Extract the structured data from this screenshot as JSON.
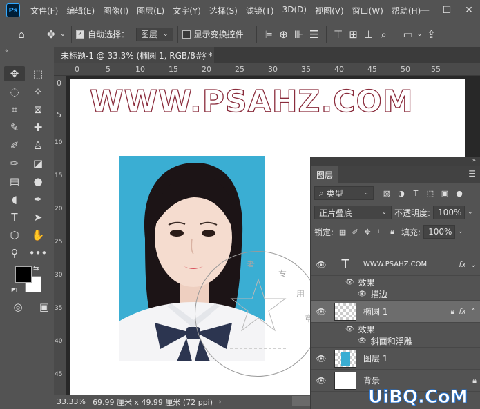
{
  "app": {
    "logo_text": "Ps",
    "menu": [
      "文件(F)",
      "编辑(E)",
      "图像(I)",
      "图层(L)",
      "文字(Y)",
      "选择(S)",
      "滤镜(T)",
      "3D(D)",
      "视图(V)",
      "窗口(W)",
      "帮助(H)"
    ],
    "window_controls": [
      "—",
      "☐",
      "✕"
    ]
  },
  "options_bar": {
    "auto_select_label": "自动选择：",
    "auto_select_checked": true,
    "auto_select_value": "图层",
    "show_transform_label": "显示变换控件",
    "show_transform_checked": false
  },
  "document": {
    "tab_title": "未标题-1 @ 33.3% (椭圆 1, RGB/8#) *",
    "close_glyph": "✕",
    "ruler_ticks": [
      "0",
      "5",
      "10",
      "15",
      "20",
      "25",
      "30",
      "35",
      "40",
      "45",
      "50",
      "55"
    ],
    "canvas_text": "WWW.PSAHZ.COM",
    "seal_text": [
      "者",
      "专",
      "用",
      "章"
    ]
  },
  "status_bar": {
    "zoom": "33.33%",
    "doc_info": "69.99 厘米 x 49.99 厘米 (72 ppi)",
    "arrow": "›"
  },
  "layers_panel": {
    "tab_label": "图层",
    "filter_kind": "类型",
    "blend_mode": "正片叠底",
    "opacity_label": "不透明度:",
    "opacity_value": "100%",
    "lock_label": "锁定:",
    "fill_label": "填充:",
    "fill_value": "100%",
    "layers": [
      {
        "name": "WWW.PSAHZ.COM",
        "thumb": "text",
        "selected": false,
        "fx": "fx",
        "effects_label": "效果",
        "effects": [
          "描边"
        ]
      },
      {
        "name": "椭圆 1",
        "thumb": "checker",
        "selected": true,
        "fx": "fx",
        "effects_label": "效果",
        "effects": [
          "斜面和浮雕"
        ]
      },
      {
        "name": "图层 1",
        "thumb": "photo",
        "selected": false
      },
      {
        "name": "背景",
        "thumb": "white",
        "selected": false
      }
    ]
  },
  "site_mark": "UiBQ.CoM",
  "colors": {
    "panel": "#535353",
    "canvas_bg": "#282828",
    "photo_bg": "#3aaed3",
    "stroke_text": "#8a2c3c",
    "site_mark": "#1c6fd1"
  }
}
